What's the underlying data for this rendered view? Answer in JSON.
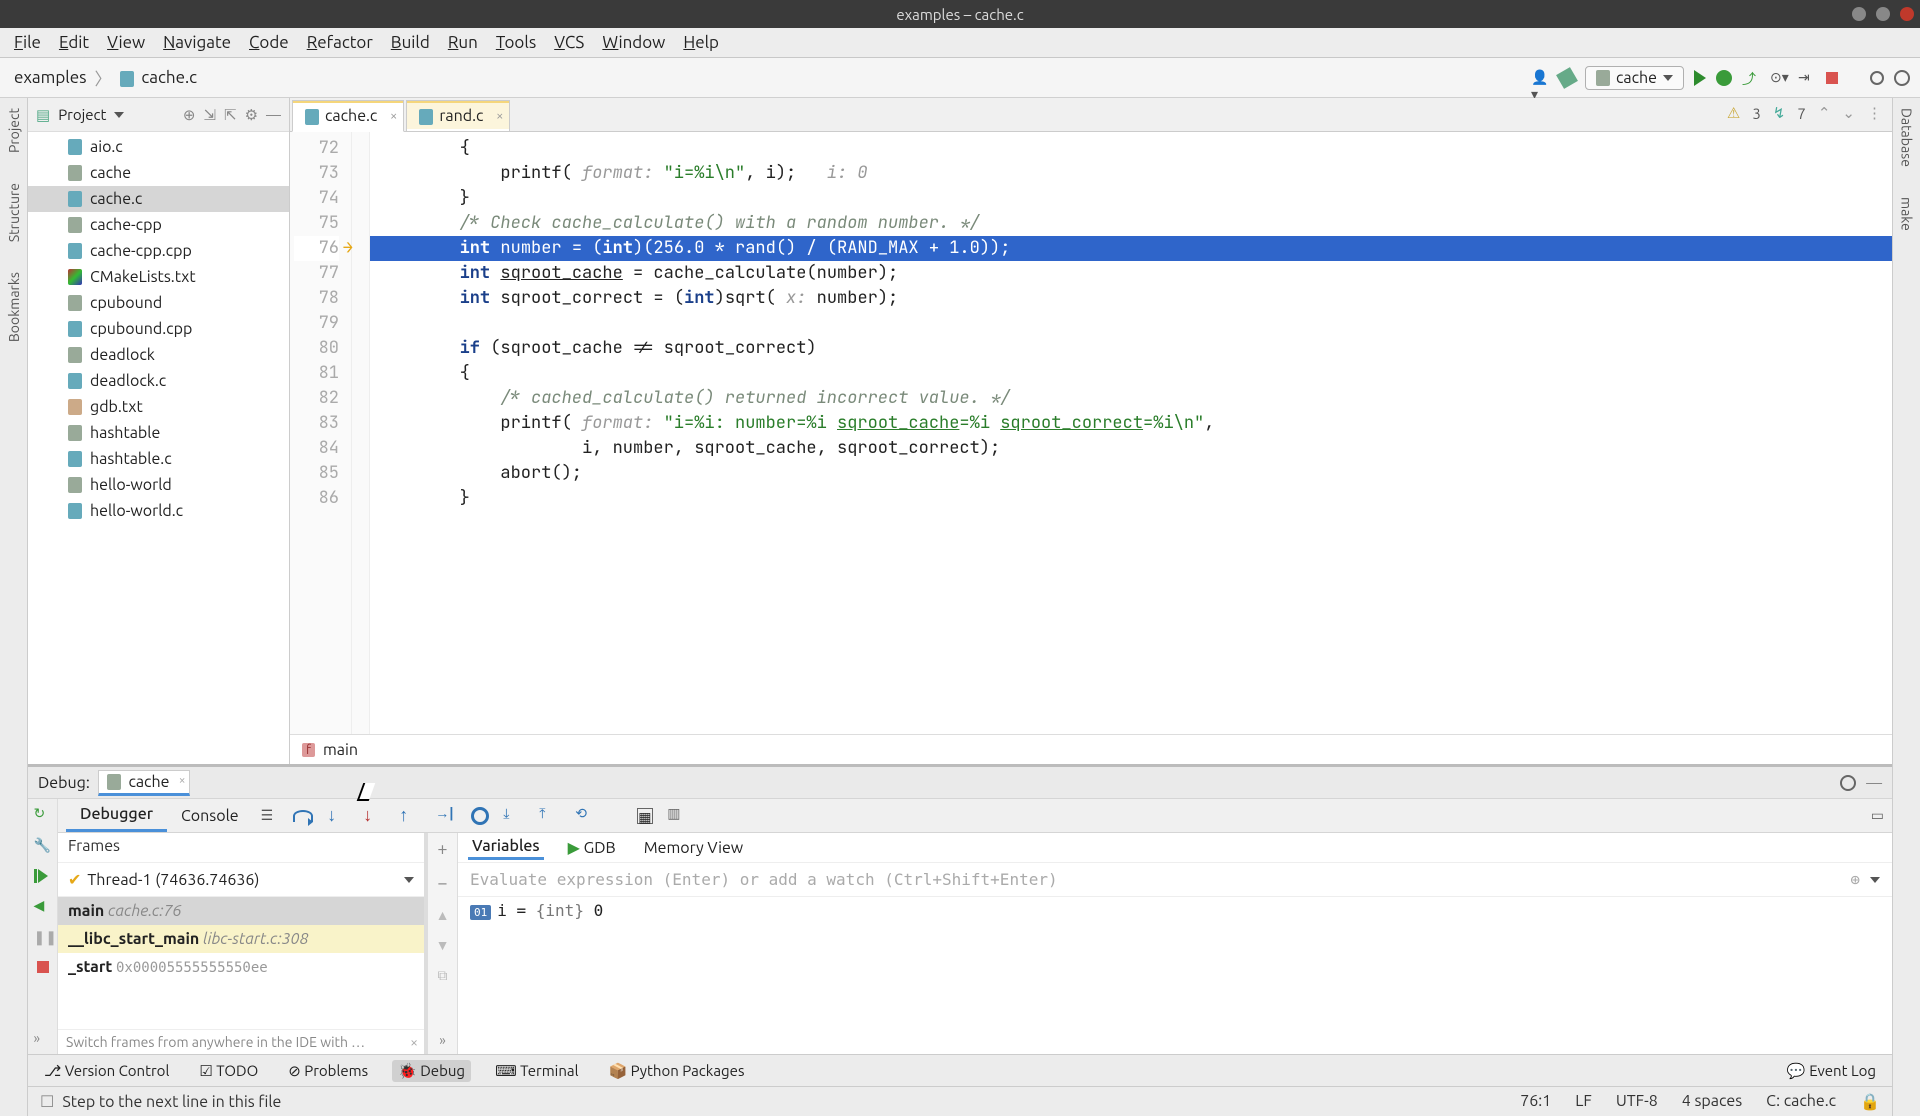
{
  "window": {
    "title": "examples – cache.c"
  },
  "menu": {
    "items": [
      "File",
      "Edit",
      "View",
      "Navigate",
      "Code",
      "Refactor",
      "Build",
      "Run",
      "Tools",
      "VCS",
      "Window",
      "Help"
    ]
  },
  "breadcrumbs": {
    "project": "examples",
    "file": "cache.c"
  },
  "run_config": {
    "selected": "cache"
  },
  "left_tabs": [
    "Project",
    "Structure",
    "Bookmarks"
  ],
  "right_tabs": [
    "Database",
    "make"
  ],
  "project_panel": {
    "title": "Project",
    "files": [
      {
        "name": "aio.c",
        "kind": "c"
      },
      {
        "name": "cache",
        "kind": "exe"
      },
      {
        "name": "cache.c",
        "kind": "c",
        "selected": true
      },
      {
        "name": "cache-cpp",
        "kind": "exe"
      },
      {
        "name": "cache-cpp.cpp",
        "kind": "c"
      },
      {
        "name": "CMakeLists.txt",
        "kind": "cmake"
      },
      {
        "name": "cpubound",
        "kind": "exe"
      },
      {
        "name": "cpubound.cpp",
        "kind": "c"
      },
      {
        "name": "deadlock",
        "kind": "exe"
      },
      {
        "name": "deadlock.c",
        "kind": "c"
      },
      {
        "name": "gdb.txt",
        "kind": "txt"
      },
      {
        "name": "hashtable",
        "kind": "exe"
      },
      {
        "name": "hashtable.c",
        "kind": "c"
      },
      {
        "name": "hello-world",
        "kind": "exe"
      },
      {
        "name": "hello-world.c",
        "kind": "c"
      }
    ]
  },
  "editor": {
    "tabs": [
      {
        "label": "cache.c",
        "active": true,
        "highlighted": true
      },
      {
        "label": "rand.c",
        "active": false,
        "highlighted": true
      }
    ],
    "inspections": {
      "warnings": "3",
      "weak": "7"
    },
    "first_line_no": 72,
    "exec_line": 76,
    "lines": [
      {
        "n": 72,
        "html": "        {"
      },
      {
        "n": 73,
        "html": "            printf( <hint>format:</hint> <str>\"i=%i\\n\"</str>, i);   <hint>i: 0</hint>"
      },
      {
        "n": 74,
        "html": "        }"
      },
      {
        "n": 75,
        "html": "        <cmt>/* Check cache_calculate() with a random number. */</cmt>"
      },
      {
        "n": 76,
        "html": "        <kw>int</kw> number = (<kw>int</kw>)(256.0 * rand() / (RAND_MAX + 1.0));",
        "exec": true
      },
      {
        "n": 77,
        "html": "        <kw>int</kw> <u>sqroot_cache</u> = cache_calculate(number);"
      },
      {
        "n": 78,
        "html": "        <kw>int</kw> sqroot_correct = (<kw>int</kw>)sqrt( <hint>x:</hint> number);"
      },
      {
        "n": 79,
        "html": ""
      },
      {
        "n": 80,
        "html": "        <kw>if</kw> (sqroot_cache != sqroot_correct)"
      },
      {
        "n": 81,
        "html": "        {"
      },
      {
        "n": 82,
        "html": "            <cmt>/* cached_calculate() returned incorrect value. */</cmt>"
      },
      {
        "n": 83,
        "html": "            printf( <hint>format:</hint> <str>\"i=%i: number=%i <u>sqroot_cache</u>=%i <u>sqroot_correct</u>=%i\\n\"</str>,"
      },
      {
        "n": 84,
        "html": "                    i, number, sqroot_cache, sqroot_correct);"
      },
      {
        "n": 85,
        "html": "            abort();"
      },
      {
        "n": 86,
        "html": "        }"
      }
    ],
    "context_crumb": "main",
    "context_badge": "f"
  },
  "debug": {
    "title": "Debug:",
    "session": "cache",
    "tabs": {
      "debugger": "Debugger",
      "console": "Console"
    },
    "frames_title": "Frames",
    "thread": "Thread-1 (74636.74636)",
    "frames": [
      {
        "name": "main",
        "loc": "cache.c:76",
        "selected": true
      },
      {
        "name": "__libc_start_main",
        "loc": "libc-start.c:308",
        "lib": true
      },
      {
        "name": "_start",
        "loc": "0x00005555555550ee",
        "hex": true
      }
    ],
    "switch_hint": "Switch frames from anywhere in the IDE with …",
    "var_tabs": {
      "variables": "Variables",
      "gdb": "GDB",
      "memory": "Memory View"
    },
    "watch_placeholder": "Evaluate expression (Enter) or add a watch (Ctrl+Shift+Enter)",
    "vars": [
      {
        "badge": "01",
        "name": "i",
        "type": "{int}",
        "value": "0"
      }
    ]
  },
  "bottom_tools": [
    {
      "label": "Version Control"
    },
    {
      "label": "TODO"
    },
    {
      "label": "Problems"
    },
    {
      "label": "Debug",
      "active": true
    },
    {
      "label": "Terminal"
    },
    {
      "label": "Python Packages"
    }
  ],
  "event_log": "Event Log",
  "status": {
    "message": "Step to the next line in this file",
    "position": "76:1",
    "line_sep": "LF",
    "encoding": "UTF-8",
    "indent": "4 spaces",
    "context": "C: cache.c"
  }
}
